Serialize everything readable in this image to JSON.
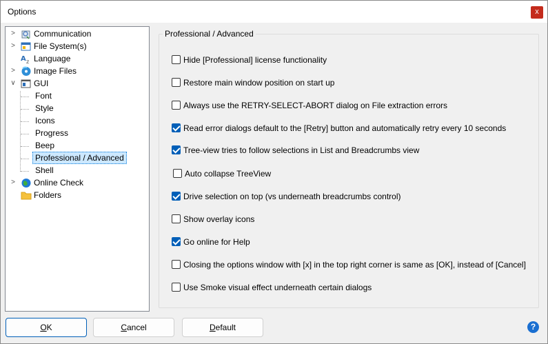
{
  "window": {
    "title": "Options",
    "close_glyph": "x"
  },
  "tree": {
    "items": [
      {
        "label": "Communication",
        "icon": "communication-icon"
      },
      {
        "label": "File System(s)",
        "icon": "file-system-icon"
      },
      {
        "label": "Language",
        "icon": "language-icon"
      },
      {
        "label": "Image Files",
        "icon": "image-files-icon"
      },
      {
        "label": "GUI",
        "icon": "gui-icon"
      },
      {
        "label": "Font"
      },
      {
        "label": "Style"
      },
      {
        "label": "Icons"
      },
      {
        "label": "Progress"
      },
      {
        "label": "Beep"
      },
      {
        "label": "Professional / Advanced",
        "selected": true
      },
      {
        "label": "Shell"
      },
      {
        "label": "Online Check",
        "icon": "globe-icon"
      },
      {
        "label": "Folders",
        "icon": "folder-icon"
      }
    ]
  },
  "panel": {
    "title": "Professional / Advanced",
    "options": [
      {
        "label": "Hide [Professional] license functionality",
        "checked": false
      },
      {
        "label": "Restore main window position on start up",
        "checked": false
      },
      {
        "label": "Always use the RETRY-SELECT-ABORT dialog on File extraction errors",
        "checked": false
      },
      {
        "label": "Read error dialogs default to the [Retry] button and automatically retry every 10 seconds",
        "checked": true
      },
      {
        "label": "Tree-view tries to follow selections in List and Breadcrumbs view",
        "checked": true
      },
      {
        "label": "Auto collapse TreeView",
        "checked": false
      },
      {
        "label": "Drive selection on top (vs underneath breadcrumbs control)",
        "checked": true
      },
      {
        "label": "Show overlay icons",
        "checked": false
      },
      {
        "label": "Go online for Help",
        "checked": true
      },
      {
        "label": "Closing the options window with [x] in the top right corner is same as [OK], instead of [Cancel]",
        "checked": false
      },
      {
        "label": "Use Smoke visual effect underneath certain dialogs",
        "checked": false
      }
    ]
  },
  "buttons": {
    "ok_first": "O",
    "ok_rest": "K",
    "cancel_first": "C",
    "cancel_rest": "ancel",
    "default_first": "D",
    "default_rest": "efault"
  },
  "help_glyph": "?",
  "colors": {
    "accent": "#005fb8",
    "close": "#c42b1c",
    "selection": "#cce8ff"
  }
}
